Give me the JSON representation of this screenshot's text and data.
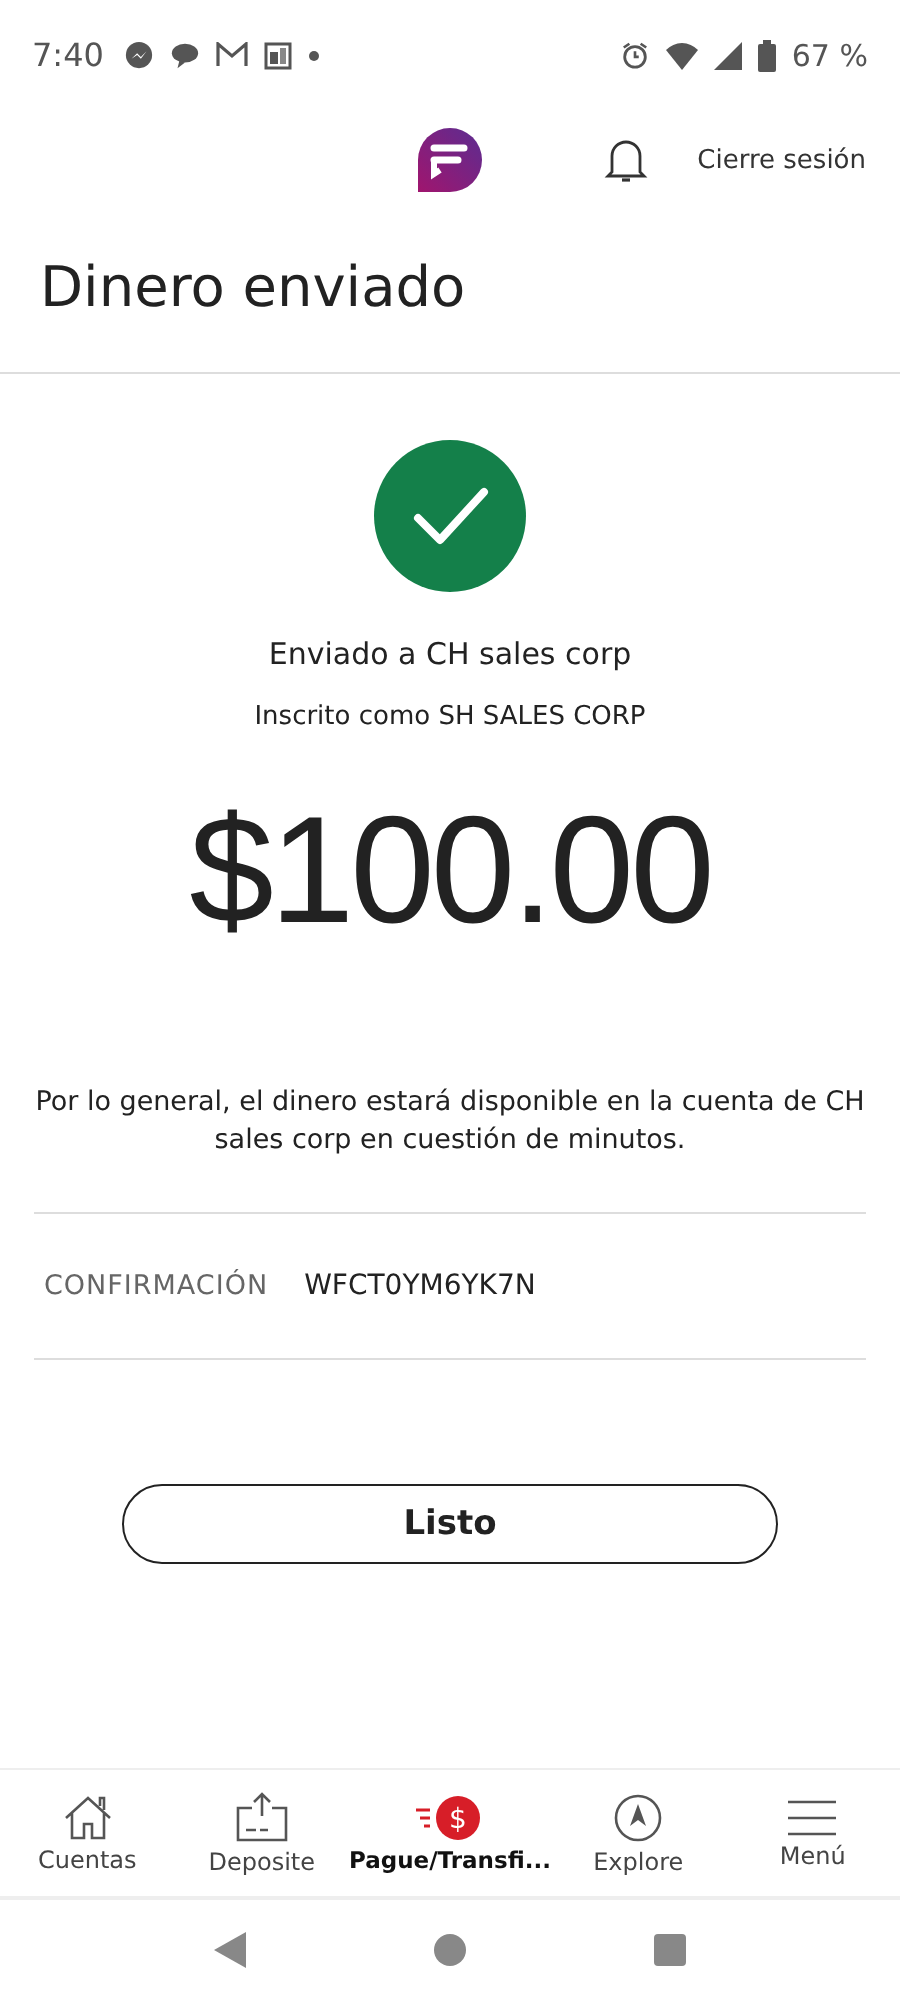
{
  "status_bar": {
    "time": "7:40",
    "battery": "67 %"
  },
  "header": {
    "logout": "Cierre sesión"
  },
  "title": "Dinero enviado",
  "recipient": "Enviado a CH sales corp",
  "enrolled": "Inscrito como SH SALES CORP",
  "amount": "$100.00",
  "note": "Por lo general, el dinero estará disponible en la cuenta de CH sales corp en cuestión de minutos.",
  "confirmation": {
    "label": "CONFIRMACIÓN",
    "value": "WFCT0YM6YK7N"
  },
  "done_button": "Listo",
  "tabs": [
    {
      "kind": "home",
      "label": "Cuentas",
      "selected": false
    },
    {
      "kind": "deposit",
      "label": "Deposite",
      "selected": false
    },
    {
      "kind": "pay",
      "icon_text": "$",
      "label": "Pague/Transfi...",
      "selected": true
    },
    {
      "kind": "explore",
      "label": "Explore",
      "selected": false
    },
    {
      "kind": "menu",
      "label": "Menú",
      "selected": false
    }
  ]
}
